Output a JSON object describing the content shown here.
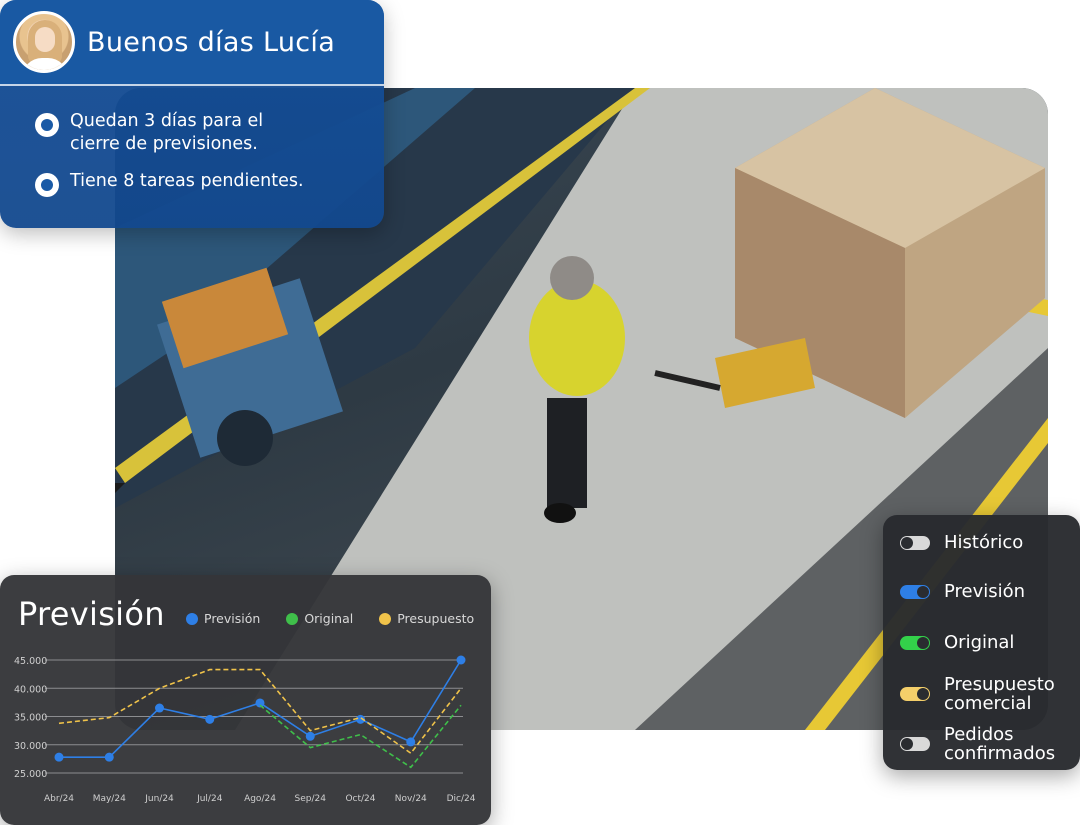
{
  "greeting": {
    "title": "Buenos días Lucía",
    "items": [
      {
        "line1": "Quedan 3 días para el",
        "line2": "cierre de previsiones."
      },
      {
        "line1": "Tiene 8 tareas pendientes.",
        "line2": ""
      }
    ]
  },
  "chart_card": {
    "title": "Previsión",
    "legend": [
      {
        "label": "Previsión",
        "color": "#2e7fe6"
      },
      {
        "label": "Original",
        "color": "#3fbf4a"
      },
      {
        "label": "Presupuesto",
        "color": "#f0c34a"
      }
    ]
  },
  "chart_data": {
    "type": "line",
    "title": "Previsión",
    "categories": [
      "Abr/24",
      "May/24",
      "Jun/24",
      "Jul/24",
      "Ago/24",
      "Sep/24",
      "Oct/24",
      "Nov/24",
      "Dic/24"
    ],
    "y_ticks": [
      "45.000",
      "40.000",
      "35.000",
      "30.000",
      "25.000"
    ],
    "y_tick_values": [
      45000,
      40000,
      35000,
      30000,
      25000
    ],
    "ylim": [
      25000,
      45000
    ],
    "grid": true,
    "legend_position": "top",
    "series": [
      {
        "name": "Previsión",
        "color": "#2e7fe6",
        "style": "solid-markers",
        "values": [
          27800,
          27800,
          36500,
          34500,
          37400,
          31500,
          34500,
          30500,
          45000
        ]
      },
      {
        "name": "Original",
        "color": "#3fbf4a",
        "style": "dashed",
        "values": [
          null,
          null,
          null,
          null,
          37000,
          29500,
          31800,
          26000,
          37000
        ]
      },
      {
        "name": "Presupuesto",
        "color": "#f0c34a",
        "style": "dashed",
        "values": [
          33800,
          34800,
          40000,
          43300,
          43300,
          32500,
          34800,
          28500,
          40000
        ]
      }
    ]
  },
  "toggles": [
    {
      "label1": "Histórico",
      "label2": "",
      "on": false,
      "color": "#d9d9d9"
    },
    {
      "label1": "Previsión",
      "label2": "",
      "on": true,
      "color": "#2e7fe6"
    },
    {
      "label1": "Original",
      "label2": "",
      "on": true,
      "color": "#33d14a"
    },
    {
      "label1": "Presupuesto",
      "label2": "comercial",
      "on": true,
      "color": "#f4cf6a"
    },
    {
      "label1": "Pedidos",
      "label2": "confirmados",
      "on": false,
      "color": "#d9d9d9"
    }
  ]
}
